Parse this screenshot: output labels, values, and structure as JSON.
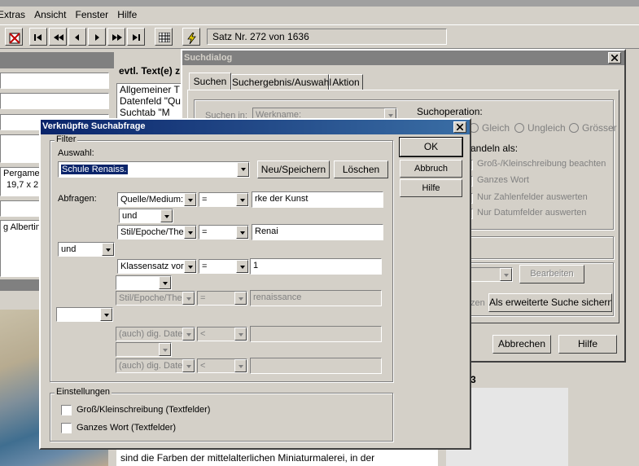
{
  "menu": {
    "items": [
      "Extras",
      "Ansicht",
      "Fenster",
      "Hilfe"
    ]
  },
  "toolbar": {
    "record_status": "Satz Nr. 272 von 1636"
  },
  "background": {
    "header_text": "evtl. Text(e) z",
    "text_lines": [
      "Allgemeiner T",
      "Datenfeld \"Qu",
      "Suchtab \"M"
    ],
    "left_fields": [
      "Pergame",
      "19,7 x 2",
      "g Albertin"
    ],
    "bottom_text": "sind die Farben der mittelalterlichen Miniaturmalerei, in der",
    "right_fragment": "3"
  },
  "suchdialog": {
    "title": "Suchdialog",
    "tabs": [
      "Suchen",
      "Suchergebnis/Auswahl",
      "Aktion"
    ],
    "suchen_in_label": "Suchen in:",
    "suchen_in_value": "Werkname:",
    "operation_label": "Suchoperation:",
    "radios": [
      "Gleich",
      "Ungleich",
      "Grösser"
    ],
    "behandeln_label": "andeln als:",
    "checks": [
      "Groß-/Kleinschreibung beachten",
      "Ganzes Wort",
      "Nur Zahlenfelder auswerten",
      "Nur Datumfelder auswerten"
    ],
    "bearbeiten": "Bearbeiten",
    "zen_fragment": "zen",
    "save_extended": "Als erweiterte Suche sichern",
    "abbrechen": "Abbrechen",
    "hilfe": "Hilfe"
  },
  "vs": {
    "title": "Verknüpfte Suchabfrage",
    "filter_label": "Filter",
    "auswahl_label": "Auswahl:",
    "auswahl_value": "Schule Renaiss.",
    "neu_speichern": "Neu/Speichern",
    "loeschen": "Löschen",
    "ok": "OK",
    "abbruch": "Abbruch",
    "hilfe": "Hilfe",
    "abfragen_label": "Abfragen:",
    "rows": [
      {
        "field": "Quelle/Medium:",
        "op": "=",
        "value": "rke der Kunst"
      },
      {
        "field": "Stil/Epoche/The",
        "op": "=",
        "value": "Renai"
      },
      {
        "field": "Klassensatz vorh",
        "op": "=",
        "value": "1"
      },
      {
        "field": "Stil/Epoche/The",
        "op": "=",
        "value": "renaissance"
      },
      {
        "field": "(auch) dig. Dater",
        "op": "<",
        "value": ""
      },
      {
        "field": "(auch) dig. Dater",
        "op": "<",
        "value": ""
      }
    ],
    "connectors": {
      "inner1": "und",
      "outer1": "und",
      "inner2": "",
      "outer2": "",
      "inner3": ""
    },
    "settings_label": "Einstellungen",
    "setting1": "Groß/Kleinschreibung (Textfelder)",
    "setting2": "Ganzes Wort (Textfelder)"
  }
}
